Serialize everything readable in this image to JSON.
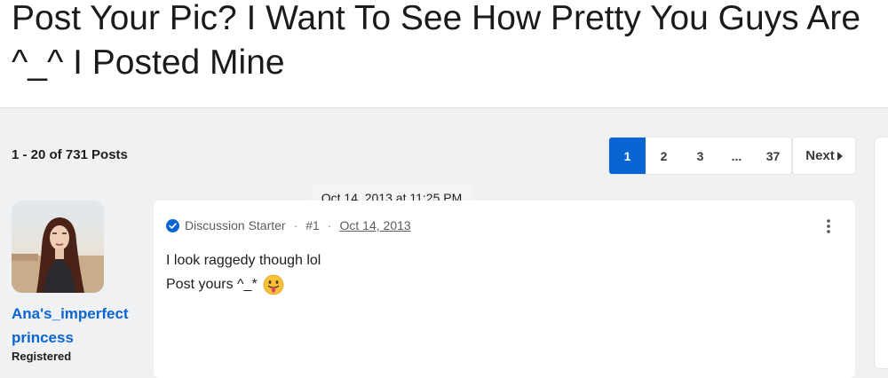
{
  "thread": {
    "title": "Post Your Pic? I Want To See How Pretty You Guys Are ^_^ I Posted Mine"
  },
  "pagination": {
    "post_count": "1 - 20 of 731 Posts",
    "pages": [
      "1",
      "2",
      "3",
      "...",
      "37"
    ],
    "current_page": "1",
    "next_label": "Next"
  },
  "colors": {
    "accent": "#0a64d1",
    "background": "#f0f1f3"
  },
  "post": {
    "tooltip_timestamp": "Oct 14, 2013 at 11:25 PM",
    "author": {
      "username": "Ana's_imperfect princess",
      "status": "Registered"
    },
    "badge": "Discussion Starter",
    "number": "#1",
    "date": "Oct 14, 2013",
    "body_line_1": "I look raggedy though lol",
    "body_line_2": "Post yours ^_*",
    "emoji": "tongue-out-emoji"
  }
}
